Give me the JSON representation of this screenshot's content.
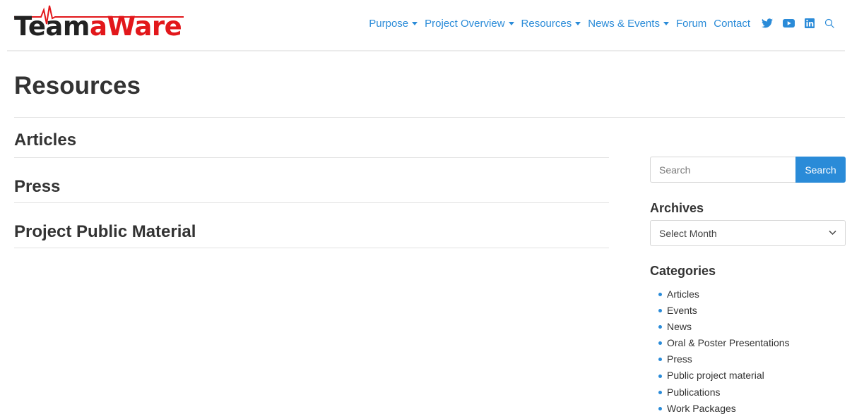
{
  "brand": {
    "logo_dark": "Team",
    "logo_red": "aWare",
    "accent_color": "#2a8bd8",
    "logo_red_color": "#e2171b"
  },
  "nav": {
    "items": [
      {
        "label": "Purpose",
        "dropdown": true
      },
      {
        "label": "Project Overview",
        "dropdown": true
      },
      {
        "label": "Resources",
        "dropdown": true
      },
      {
        "label": "News & Events",
        "dropdown": true
      },
      {
        "label": "Forum",
        "dropdown": false
      },
      {
        "label": "Contact",
        "dropdown": false
      }
    ],
    "social_icons": [
      "twitter-icon",
      "youtube-icon",
      "linkedin-icon"
    ],
    "search_icon": "search-icon"
  },
  "page": {
    "title": "Resources"
  },
  "sections": [
    {
      "title": "Articles"
    },
    {
      "title": "Press"
    },
    {
      "title": "Project Public Material"
    }
  ],
  "sidebar": {
    "search_placeholder": "Search",
    "search_button": "Search",
    "archives_title": "Archives",
    "archives_select": "Select Month",
    "categories_title": "Categories",
    "categories": [
      "Articles",
      "Events",
      "News",
      "Oral & Poster Presentations",
      "Press",
      "Public project material",
      "Publications",
      "Work Packages"
    ]
  }
}
